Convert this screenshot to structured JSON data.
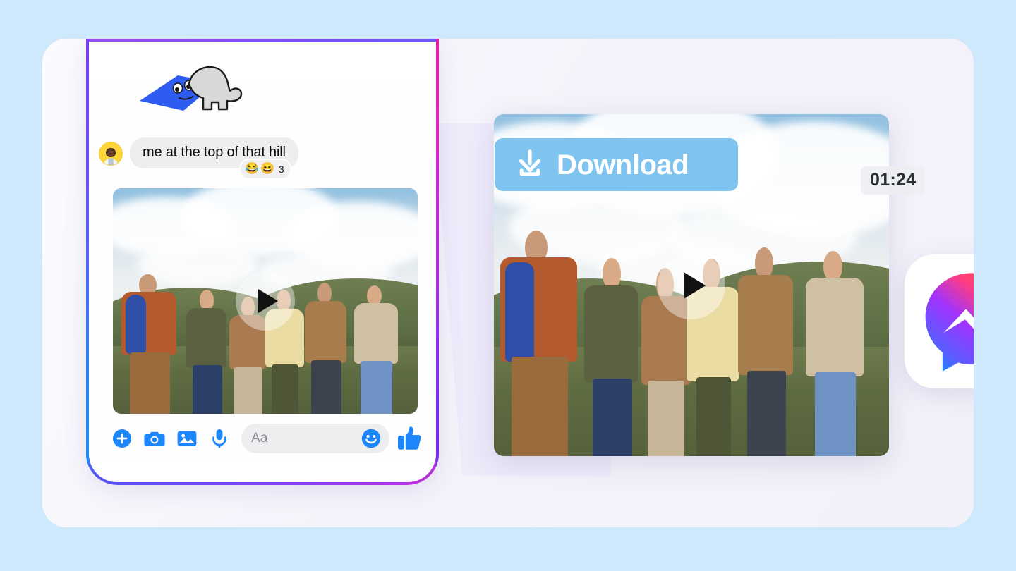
{
  "page": {
    "background_color": "#cde9fb",
    "card_color": "#f3f2fa"
  },
  "phone": {
    "bezel_gradient_left": "#7b3cf5 -> #1f8cf7",
    "bezel_gradient_right": "#e81fa8 -> #7a28e8",
    "sticker": {
      "name": "blob-sticker",
      "card_color": "#2f5cf0",
      "blob_color": "#d8d8d8"
    },
    "message": {
      "avatar_name": "sender-avatar",
      "avatar_bg": "#ffd33a",
      "text": "me at the top of that hill",
      "reactions": {
        "emojis": [
          "😂",
          "😆"
        ],
        "count": "3"
      }
    },
    "attachment": {
      "name": "video-thumbnail",
      "kind": "video",
      "play_button_label": "play"
    },
    "composer": {
      "icons": [
        {
          "name": "plus-icon",
          "label": "Add"
        },
        {
          "name": "camera-icon",
          "label": "Camera"
        },
        {
          "name": "image-icon",
          "label": "Gallery"
        },
        {
          "name": "microphone-icon",
          "label": "Voice"
        }
      ],
      "input_placeholder": "Aa",
      "input_value": "",
      "emoji_button": {
        "name": "smiley-icon",
        "label": "Emoji"
      },
      "like_button": {
        "name": "thumbs-up-icon",
        "label": "Like"
      },
      "icon_color": "#1d86fa"
    }
  },
  "player": {
    "name": "video-player",
    "timestamp": "01:24",
    "play_button_label": "play",
    "download_button": {
      "label": "Download",
      "icon": "download-icon",
      "bg_color": "#7fc4ee",
      "text_color": "#ffffff"
    }
  },
  "brand": {
    "logo_name": "messenger-logo",
    "gradient_start": "#00b2ff",
    "gradient_mid": "#a033ff",
    "gradient_end": "#ff5280"
  }
}
